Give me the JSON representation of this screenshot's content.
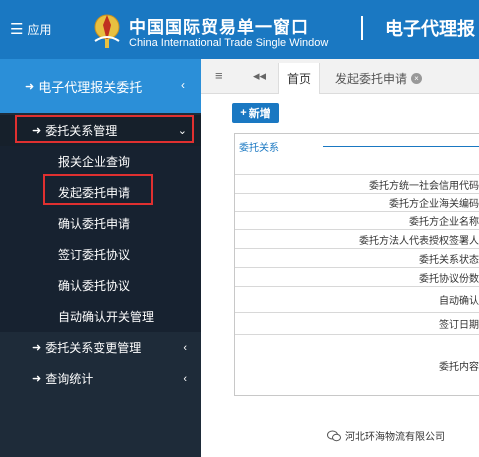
{
  "header": {
    "apps_label": "应用",
    "title_cn": "中国国际贸易单一窗口",
    "title_en": "China International Trade Single Window",
    "system_title": "电子代理报"
  },
  "sidebar": {
    "section_title": "电子代理报关委托",
    "items": [
      {
        "label": "委托关系管理"
      },
      {
        "label": "委托关系变更管理"
      },
      {
        "label": "查询统计"
      }
    ],
    "subitems": [
      {
        "label": "报关企业查询"
      },
      {
        "label": "发起委托申请"
      },
      {
        "label": "确认委托申请"
      },
      {
        "label": "签订委托协议"
      },
      {
        "label": "确认委托协议"
      },
      {
        "label": "自动确认开关管理"
      }
    ]
  },
  "tabs": {
    "home": "首页",
    "current": "发起委托申请"
  },
  "main": {
    "new_button": "新增",
    "panel_title": "委托关系",
    "fields": [
      "委托方统一社会信用代码",
      "委托方企业海关编码",
      "委托方企业名称",
      "委托方法人代表授权签署人",
      "委托关系状态",
      "委托协议份数",
      "自动确认",
      "签订日期",
      "委托内容"
    ]
  },
  "watermark": "河北环海物流有限公司",
  "colors": {
    "header_blue": "#1a78c2",
    "sidebar_dark": "#1e2b39",
    "sidebar_head": "#2b8fd8",
    "highlight_red": "#e03030"
  }
}
